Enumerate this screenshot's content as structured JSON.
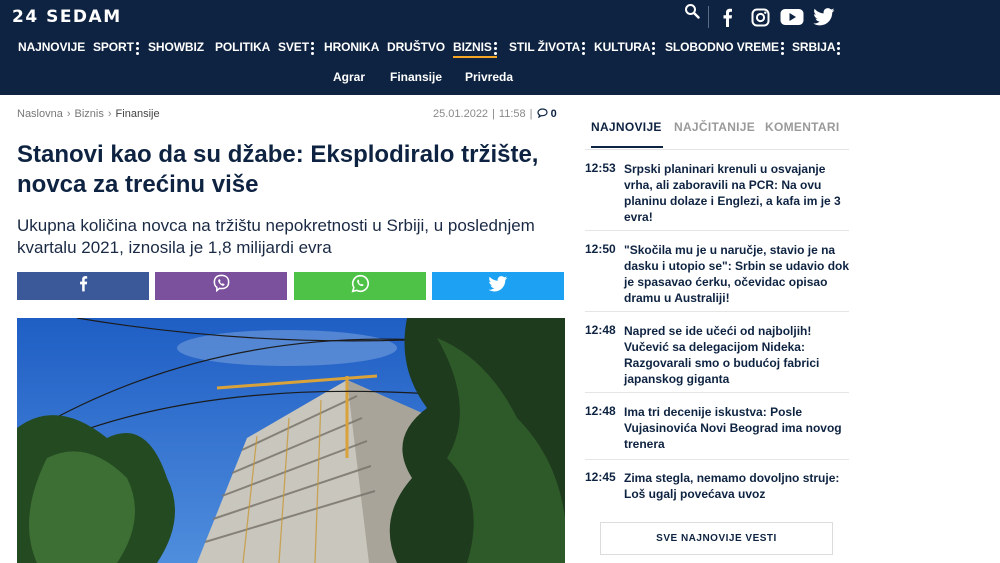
{
  "site": {
    "logo": "24 SEDAM"
  },
  "header_icons": [
    "search-icon",
    "facebook-icon",
    "instagram-icon",
    "youtube-icon",
    "twitter-icon"
  ],
  "nav": {
    "items": [
      {
        "label": "NAJNOVIJE",
        "has_menu": false
      },
      {
        "label": "SPORT",
        "has_menu": true
      },
      {
        "label": "SHOWBIZ",
        "has_menu": false
      },
      {
        "label": "POLITIKA",
        "has_menu": false
      },
      {
        "label": "SVET",
        "has_menu": true
      },
      {
        "label": "HRONIKA",
        "has_menu": false
      },
      {
        "label": "DRUŠTVO",
        "has_menu": false
      },
      {
        "label": "BIZNIS",
        "has_menu": true,
        "active": true
      },
      {
        "label": "STIL ŽIVOTA",
        "has_menu": true
      },
      {
        "label": "KULTURA",
        "has_menu": true
      },
      {
        "label": "SLOBODNO VREME",
        "has_menu": true
      },
      {
        "label": "SRBIJA",
        "has_menu": true
      }
    ],
    "sub_items": [
      "Agrar",
      "Finansije",
      "Privreda"
    ]
  },
  "breadcrumb": {
    "items": [
      "Naslovna",
      "Biznis",
      "Finansije"
    ]
  },
  "article": {
    "date": "25.01.2022",
    "time": "11:58",
    "comment_count": "0",
    "title": "Stanovi kao da su džabe: Eksplodiralo tržište, novca za trećinu više",
    "lead": "Ukupna količina novca na tržištu nepokretnosti u Srbiji, u poslednjem kvartalu 2021, iznosila je 1,8 milijardi evra"
  },
  "share": [
    {
      "name": "facebook",
      "color": "#3b5998",
      "icon": "facebook-icon"
    },
    {
      "name": "viber",
      "color": "#7b519d",
      "icon": "viber-icon"
    },
    {
      "name": "whatsapp",
      "color": "#4dc247",
      "icon": "whatsapp-icon"
    },
    {
      "name": "twitter",
      "color": "#1da1f2",
      "icon": "twitter-icon"
    }
  ],
  "sidebar": {
    "tabs": [
      {
        "label": "NAJNOVIJE",
        "active": true
      },
      {
        "label": "NAJČITANIJE",
        "active": false
      },
      {
        "label": "KOMENTARI",
        "active": false
      }
    ],
    "news": [
      {
        "time": "12:53",
        "title": "Srpski planinari krenuli u osvajanje vrha, ali zaboravili na PCR: Na ovu planinu dolaze i Englezi, a kafa im je 3 evra!"
      },
      {
        "time": "12:50",
        "title": "\"Skočila mu je u naručje, stavio je na dasku i utopio se\": Srbin se udavio dok je spasavao ćerku, očevidac opisao dramu u Australiji!"
      },
      {
        "time": "12:48",
        "title": "Napred se ide učeći od najboljih! Vučević sa delegacijom Nideka: Razgovarali smo o budućoj fabrici japanskog giganta"
      },
      {
        "time": "12:48",
        "title": "Ima tri decenije iskustva: Posle Vujasinovića Novi Beograd ima novog trenera"
      },
      {
        "time": "12:45",
        "title": "Zima stegla, nemamo dovoljno struje: Loš ugalj povećava uvoz"
      }
    ],
    "all_button": "SVE NAJNOVIJE VESTI"
  },
  "colors": {
    "header_bg": "#0e2341",
    "accent": "#f5a623",
    "text_dark": "#0e2341"
  }
}
